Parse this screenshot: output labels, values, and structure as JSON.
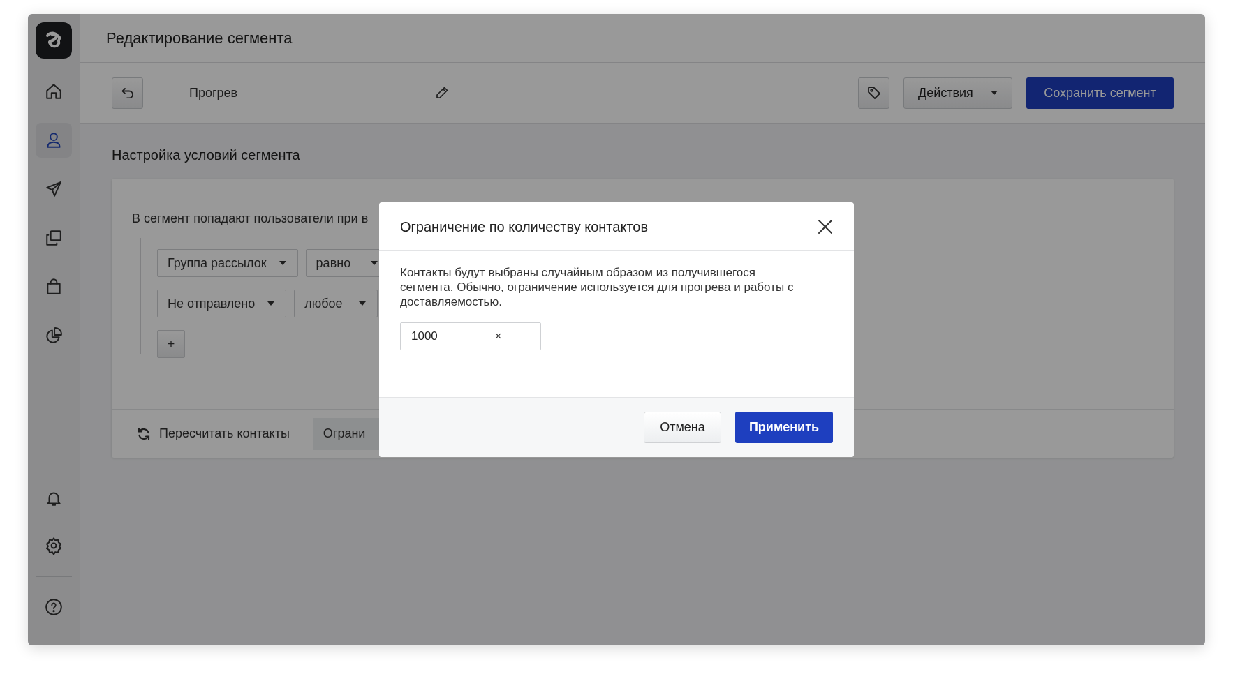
{
  "header": {
    "title": "Редактирование сегмента"
  },
  "sidebar": {
    "items": [
      {
        "selected": false
      },
      {
        "selected": true
      },
      {
        "selected": false
      },
      {
        "selected": false
      },
      {
        "selected": false
      },
      {
        "selected": false
      },
      {
        "selected": false
      },
      {
        "selected": false
      },
      {
        "selected": false
      }
    ]
  },
  "toolbar": {
    "segment_name": "Прогрев",
    "actions_button": "Действия",
    "save_button": "Сохранить сегмент"
  },
  "section_title": "Настройка условий сегмента",
  "conditions": {
    "intro": "В сегмент попадают пользователи при в",
    "rows": [
      {
        "field": "Группа рассылок",
        "operator": "равно"
      },
      {
        "field": "Не отправлено",
        "operator": "любое"
      }
    ],
    "add_button": "+"
  },
  "card_footer": {
    "recalculate": "Пересчитать контакты",
    "limit_button": "Ограни"
  },
  "modal": {
    "title": "Ограничение по количеству контактов",
    "description": "Контакты будут выбраны случайным образом из получившегося сегмента. Обычно, ограничение используется для прогрева и работы с доставляемостью.",
    "input_value": "1000",
    "clear_button": "×",
    "cancel_button": "Отмена",
    "apply_button": "Применить"
  }
}
